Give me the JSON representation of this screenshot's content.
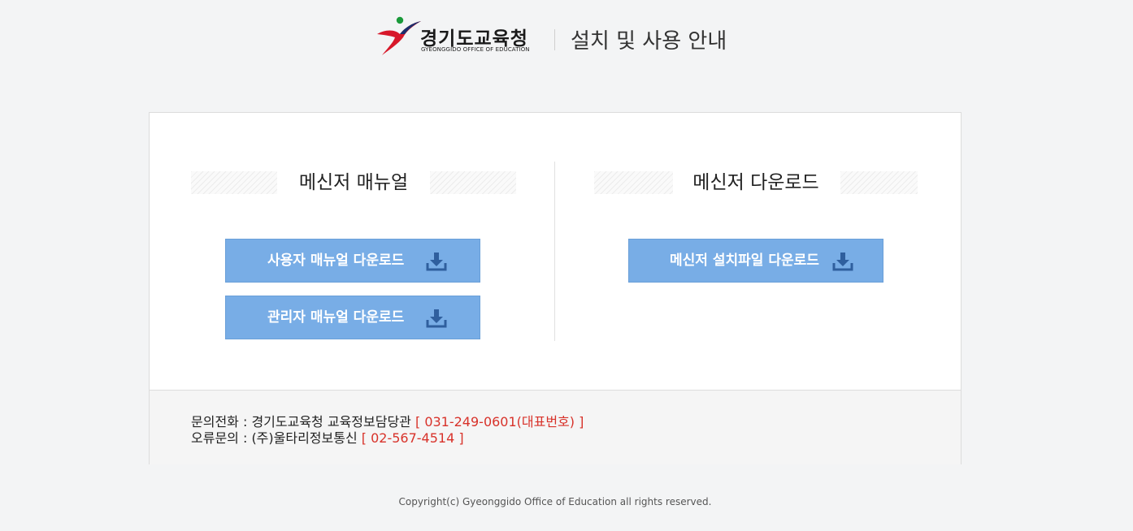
{
  "header": {
    "logo_ko": "경기도교육청",
    "logo_en": "GYEONGGIDO OFFICE OF EDUCATION",
    "title": "설치 및 사용 안내"
  },
  "manual_section": {
    "title": "메신저 매뉴얼",
    "buttons": [
      {
        "label": "사용자 매뉴얼 다운로드",
        "icon": "download-icon"
      },
      {
        "label": "관리자 매뉴얼 다운로드",
        "icon": "download-icon"
      }
    ]
  },
  "download_section": {
    "title": "메신저 다운로드",
    "buttons": [
      {
        "label": "메신저 설치파일 다운로드",
        "icon": "download-icon"
      }
    ]
  },
  "contact": {
    "line1_label": "문의전화 : 경기도교육청 교육정보담당관",
    "line1_value": "[ 031-249-0601(대표번호) ]",
    "line2_label": "오류문의 : (주)울타리정보통신",
    "line2_value": "[ 02-567-4514 ]"
  },
  "footer": {
    "copyright": "Copyright(c) Gyeonggido Office of Education all rights reserved."
  },
  "colors": {
    "background": "#f3f4f5",
    "button": "#78ade6",
    "accent_red": "#d8322a",
    "logo_red": "#d7182a",
    "logo_green": "#1a9a3a",
    "logo_navy": "#1b2f6e"
  }
}
